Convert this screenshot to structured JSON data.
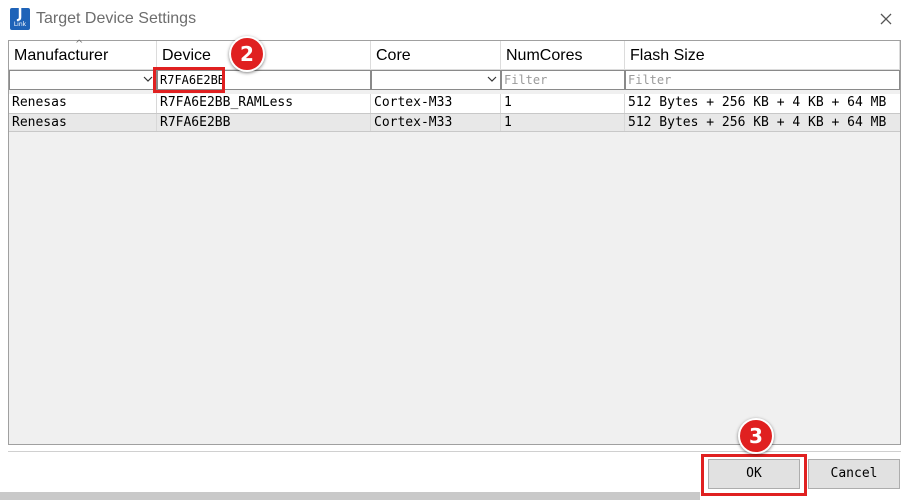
{
  "window": {
    "icon_text_top": "J",
    "icon_text_bottom": "Link",
    "title": "Target Device Settings"
  },
  "table": {
    "columns": [
      "Manufacturer",
      "Device",
      "Core",
      "NumCores",
      "Flash Size"
    ],
    "filters": {
      "manufacturer": "",
      "device": "R7FA6E2BB",
      "core": "",
      "numcores_placeholder": "Filter",
      "flash_placeholder": "Filter"
    },
    "rows": [
      [
        "Renesas",
        "R7FA6E2BB_RAMLess",
        "Cortex-M33",
        "1",
        "512 Bytes + 256 KB + 4 KB + 64 MB"
      ],
      [
        "Renesas",
        "R7FA6E2BB",
        "Cortex-M33",
        "1",
        "512 Bytes + 256 KB + 4 KB + 64 MB"
      ]
    ]
  },
  "callouts": {
    "step2": "2",
    "step3": "3"
  },
  "buttons": {
    "ok": "OK",
    "cancel": "Cancel"
  },
  "colors": {
    "accent": "#e02020",
    "icon": "#1e63b8"
  }
}
